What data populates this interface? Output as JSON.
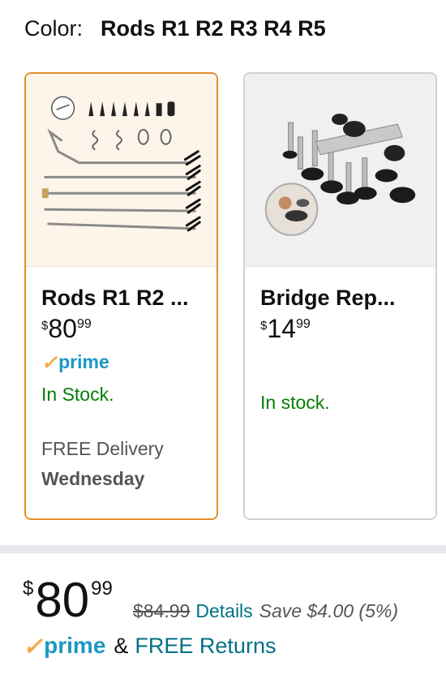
{
  "color_selector": {
    "label": "Color:",
    "selected_value": "Rods R1 R2 R3 R4 R5"
  },
  "options": [
    {
      "title": "Rods R1 R2 ...",
      "price": {
        "currency": "$",
        "whole": "80",
        "fraction": "99"
      },
      "prime_check": "✓",
      "prime_label": "prime",
      "stock": "In Stock.",
      "delivery": "FREE Delivery",
      "delivery_day": "Wednesday",
      "selected": true
    },
    {
      "title": "Bridge Rep...",
      "price": {
        "currency": "$",
        "whole": "14",
        "fraction": "99"
      },
      "stock": "In stock.",
      "selected": false
    }
  ],
  "buybox": {
    "price": {
      "currency": "$",
      "whole": "80",
      "fraction": "99"
    },
    "list_price": "$84.99",
    "details_link": "Details",
    "savings": "Save $4.00 (5%)",
    "prime_check": "✓",
    "prime_label": "prime",
    "ampersand": "&",
    "free_returns": "FREE Returns"
  },
  "colors": {
    "selected_border": "#e3902d",
    "stock_green": "#087c06",
    "link_teal": "#007185",
    "prime_blue": "#1a98c2",
    "prime_orange": "#f3a847"
  }
}
